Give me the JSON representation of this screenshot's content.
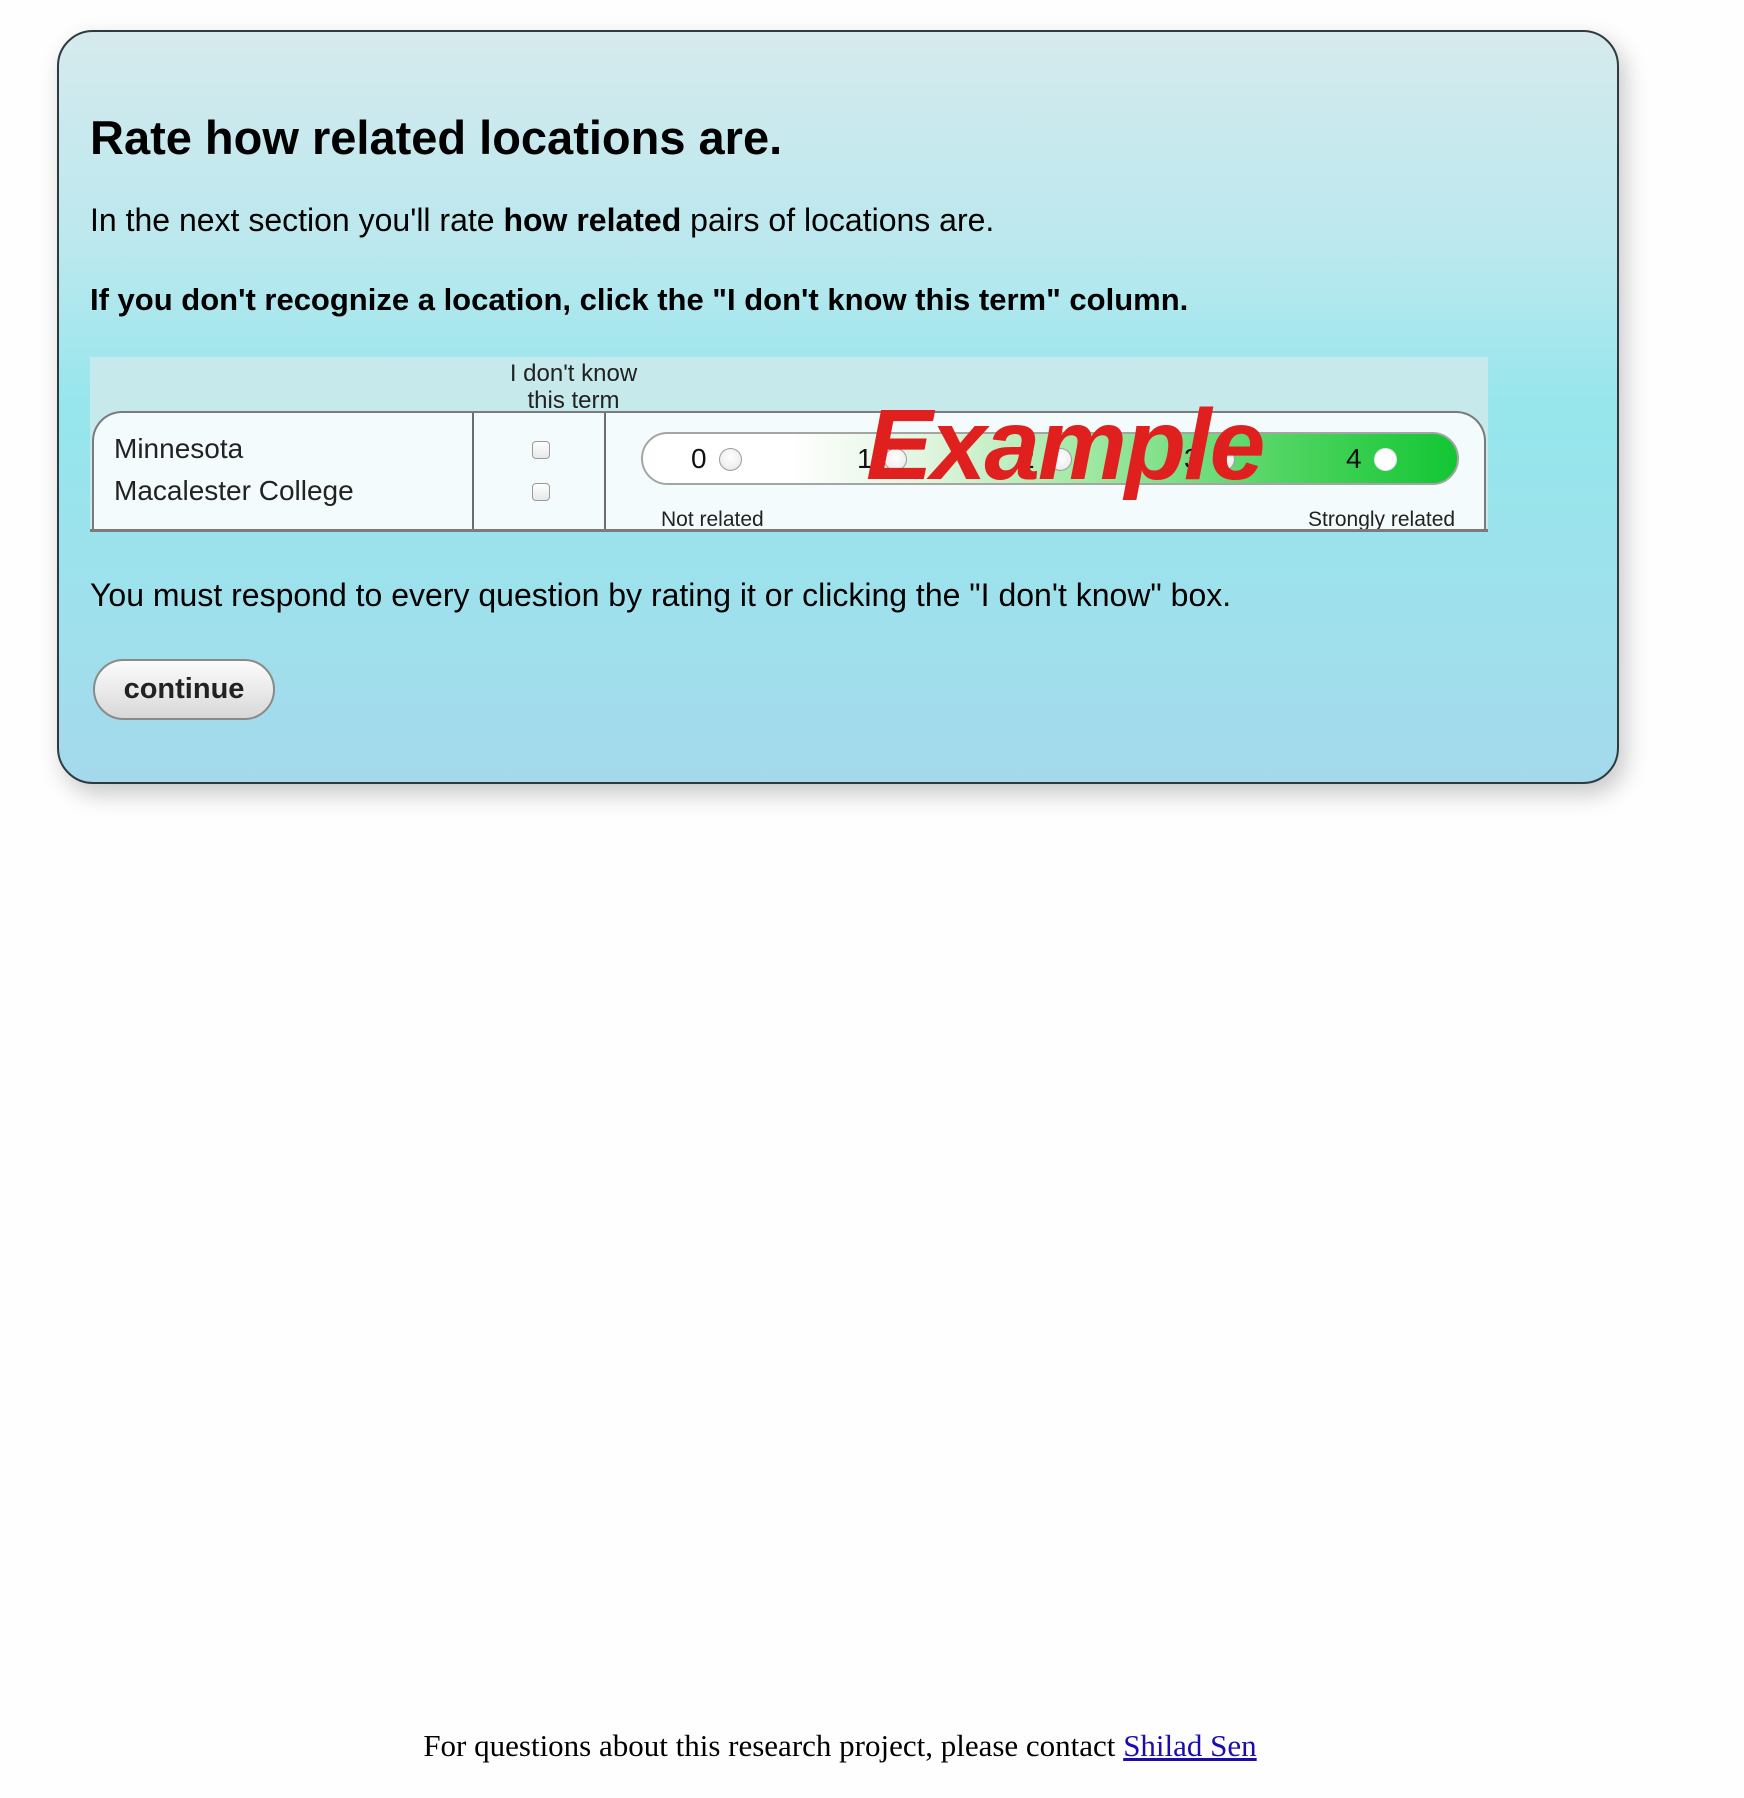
{
  "panel": {
    "heading": "Rate how related locations are.",
    "intro_before": "In the next section you'll rate ",
    "intro_bold": "how related",
    "intro_after": " pairs of locations are.",
    "instruction": "If you don't recognize a location, click the \"I don't know this term\" column.",
    "must_respond": "You must respond to every question by rating it or clicking the \"I don't know\" box.",
    "continue_label": "continue"
  },
  "example": {
    "dont_know_header_line1": "I don't know",
    "dont_know_header_line2": "this term",
    "term1": "Minnesota",
    "term2": "Macalester College",
    "scale_numbers": [
      "0",
      "1",
      "2",
      "3",
      "4"
    ],
    "low_label": "Not related",
    "high_label": "Strongly related",
    "watermark": "Example",
    "colors": {
      "watermark": "#e0201e",
      "scale_high": "#12c633"
    }
  },
  "footer": {
    "text": "For questions about this research project, please contact ",
    "link_text": "Shilad Sen"
  }
}
